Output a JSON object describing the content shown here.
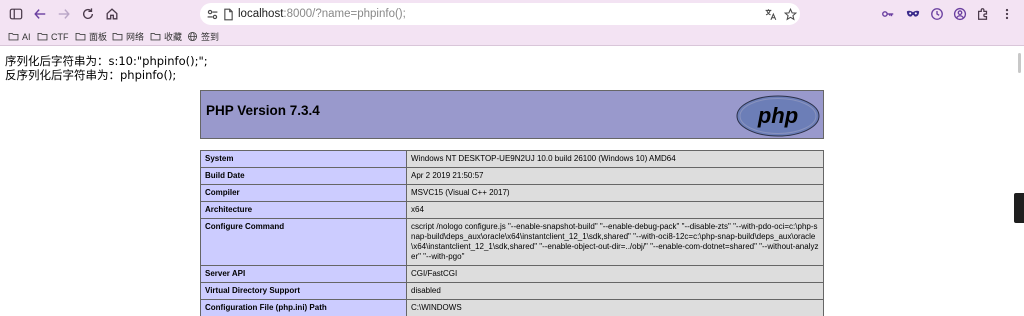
{
  "browser": {
    "url_host": "localhost",
    "url_rest": ":8000/?name=phpinfo();",
    "bookmarks": [
      {
        "label": "AI",
        "icon": "folder-icon"
      },
      {
        "label": "CTF",
        "icon": "folder-icon"
      },
      {
        "label": "面板",
        "icon": "folder-icon"
      },
      {
        "label": "网络",
        "icon": "folder-icon"
      },
      {
        "label": "收藏",
        "icon": "folder-icon"
      },
      {
        "label": "签到",
        "icon": "globe-icon"
      }
    ]
  },
  "output": {
    "line1": "序列化后字符串为：s:10:\"phpinfo();\";",
    "line2": "反序列化后字符串为：phpinfo();"
  },
  "phpinfo": {
    "title": "PHP Version 7.3.4",
    "logo_text": "php",
    "rows": [
      {
        "key": "System",
        "value": "Windows NT DESKTOP-UE9N2UJ 10.0 build 26100 (Windows 10) AMD64"
      },
      {
        "key": "Build Date",
        "value": "Apr 2 2019 21:50:57"
      },
      {
        "key": "Compiler",
        "value": "MSVC15 (Visual C++ 2017)"
      },
      {
        "key": "Architecture",
        "value": "x64"
      },
      {
        "key": "Configure Command",
        "value": "cscript /nologo configure.js \"--enable-snapshot-build\" \"--enable-debug-pack\" \"--disable-zts\" \"--with-pdo-oci=c:\\php-snap-build\\deps_aux\\oracle\\x64\\instantclient_12_1\\sdk,shared\" \"--with-oci8-12c=c:\\php-snap-build\\deps_aux\\oracle\\x64\\instantclient_12_1\\sdk,shared\" \"--enable-object-out-dir=../obj/\" \"--enable-com-dotnet=shared\" \"--without-analyzer\" \"--with-pgo\""
      },
      {
        "key": "Server API",
        "value": "CGI/FastCGI"
      },
      {
        "key": "Virtual Directory Support",
        "value": "disabled"
      },
      {
        "key": "Configuration File (php.ini) Path",
        "value": "C:\\WINDOWS"
      }
    ]
  },
  "colors": {
    "header_bg": "#9999cc",
    "key_bg": "#ccccff",
    "value_bg": "#dddddd",
    "chrome_bg": "#f3e3f3"
  }
}
